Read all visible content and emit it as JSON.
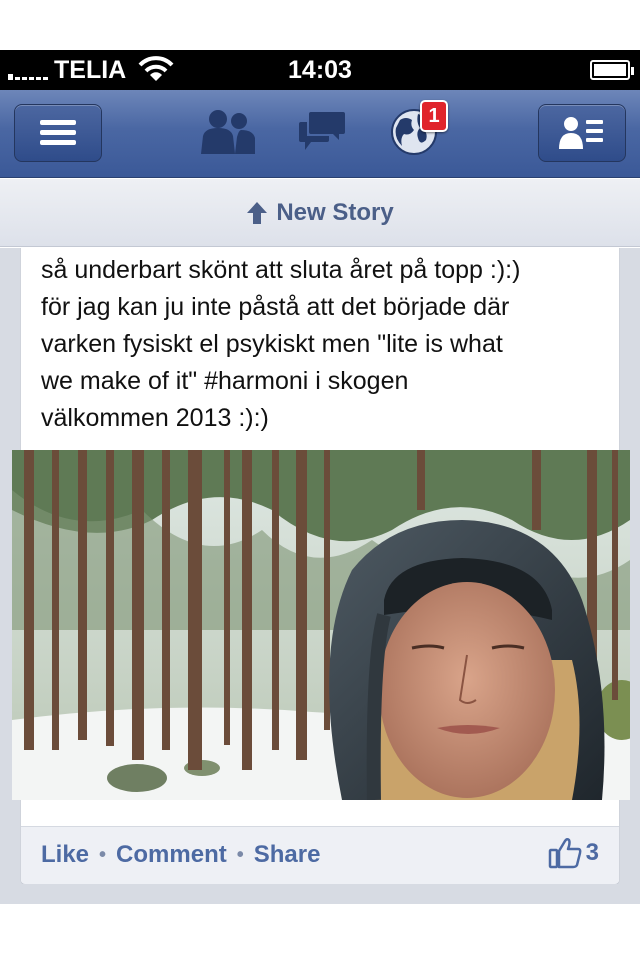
{
  "status_bar": {
    "carrier": "TELIA",
    "time": "14:03",
    "signal_icon": "signal-dots-icon",
    "wifi_icon": "wifi-icon",
    "battery_icon": "battery-full-icon"
  },
  "nav_bar": {
    "menu_icon": "hamburger-menu-icon",
    "friend_requests_icon": "friend-requests-icon",
    "messages_icon": "messages-icon",
    "notifications_icon": "globe-notifications-icon",
    "notifications_badge": "1",
    "profile_icon": "contact-card-icon",
    "colors": {
      "bar": "#3b5998",
      "badge": "#e0242b"
    }
  },
  "new_story": {
    "label": "New Story",
    "icon": "arrow-up-icon"
  },
  "post": {
    "text": "så underbart skönt att sluta året på topp :):)\nför jag kan ju inte påstå att det började där\nvarken fysiskt el psykiskt men \"lite is what\nwe make of it\" #harmoni i skogen\nvälkommen 2013 :):)",
    "photo": "forest-selfie-photo",
    "actions": {
      "like": "Like",
      "comment": "Comment",
      "share": "Share",
      "separator": "•"
    },
    "like_count": "3",
    "like_icon": "thumbs-up-icon"
  }
}
